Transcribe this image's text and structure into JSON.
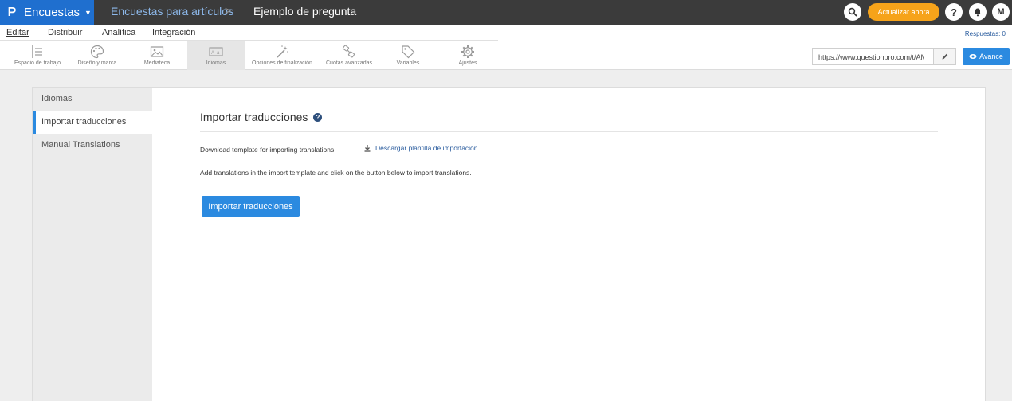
{
  "topbar": {
    "brand_logo": "P",
    "brand_name": "Encuestas",
    "breadcrumb_survey": "Encuestas para artículos",
    "breadcrumb_separator": ">",
    "breadcrumb_page": "Ejemplo de pregunta",
    "upgrade_label": "Actualizar ahora",
    "help_glyph": "?",
    "user_initial": "M"
  },
  "nav": {
    "items": [
      "Editar",
      "Distribuir",
      "Analítica",
      "Integración"
    ],
    "responses": "Respuestas: 0"
  },
  "toolbar": {
    "tools": [
      {
        "label": "Espacio de trabajo",
        "icon": "workspace-icon"
      },
      {
        "label": "Diseño y marca",
        "icon": "palette-icon"
      },
      {
        "label": "Mediateca",
        "icon": "image-icon"
      },
      {
        "label": "Idiomas",
        "icon": "language-icon"
      },
      {
        "label": "Opciones de finalización",
        "icon": "magic-wand-icon"
      },
      {
        "label": "Cuotas avanzadas",
        "icon": "quota-icon"
      },
      {
        "label": "Variables",
        "icon": "tag-icon"
      },
      {
        "label": "Ajustes",
        "icon": "gear-icon"
      }
    ],
    "url": "https://www.questionpro.com/t/AM",
    "preview_label": "Avance"
  },
  "sidebar": {
    "items": [
      "Idiomas",
      "Importar traducciones",
      "Manual Translations"
    ]
  },
  "main": {
    "heading": "Importar traducciones",
    "download_label": "Download template for importing translations:",
    "download_link": "Descargar plantilla de importación",
    "instructions": "Add translations in the import template and click on the button below to import translations.",
    "import_button": "Importar traducciones"
  },
  "colors": {
    "brand_blue": "#1f6fcf",
    "button_blue": "#2b8ae0",
    "upgrade_orange": "#f6a31a",
    "topbar_dark": "#3b3b3b"
  }
}
